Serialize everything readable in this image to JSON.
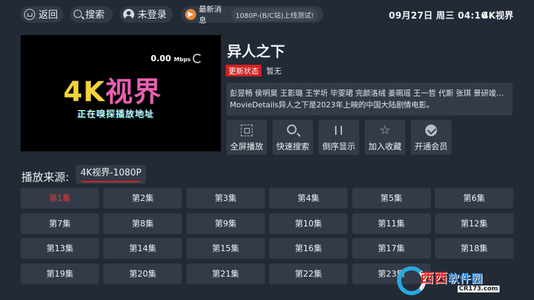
{
  "topbar": {
    "back_label": "返回",
    "search_label": "搜索",
    "login_label": "未登录",
    "news_label": "最新消息",
    "news_text": "1080P-(B/C站)上线测试!",
    "clock": "09月27日 周三 04:16",
    "brand": "4K视界"
  },
  "player": {
    "speed_value": "0.00",
    "speed_unit": "Mbps",
    "logo_part1": "4K",
    "logo_part2": "视界",
    "loading_text": "正在嗅探播放地址"
  },
  "info": {
    "title": "异人之下",
    "status_badge": "更新状态",
    "status_value": "暂无",
    "cast_line": "彭昱畅 侯明昊 王影璐 王学圻 毕雯珺 完颜洛绒 姜珮瑶 王一哲 代斯 张琪 景研竣…",
    "synopsis_line": "MovieDetails异人之下是2023年上映的中国大陆剧情电影。"
  },
  "actions": [
    {
      "label": "全屏播放",
      "icon": "fullscreen-icon"
    },
    {
      "label": "快速搜索",
      "icon": "search-icon"
    },
    {
      "label": "倒序显示",
      "icon": "sort-icon"
    },
    {
      "label": "加入收藏",
      "icon": "star-icon"
    },
    {
      "label": "开通会员",
      "icon": "vip-icon"
    }
  ],
  "source": {
    "label": "播放来源:",
    "selected": "4K视界-1080P"
  },
  "episodes": {
    "active_index": 0,
    "items": [
      "第1集",
      "第2集",
      "第3集",
      "第4集",
      "第5集",
      "第6集",
      "第7集",
      "第8集",
      "第9集",
      "第10集",
      "第11集",
      "第12集",
      "第13集",
      "第14集",
      "第15集",
      "第16集",
      "第17集",
      "第18集",
      "第19集",
      "第20集",
      "第21集",
      "第22集",
      "第23集"
    ]
  },
  "watermark": {
    "brand": "西西",
    "brand2": "软件园",
    "url": "CR173.com"
  },
  "colors": {
    "background": "#222a36",
    "panel": "#333b48",
    "accent_red": "#d12121"
  }
}
